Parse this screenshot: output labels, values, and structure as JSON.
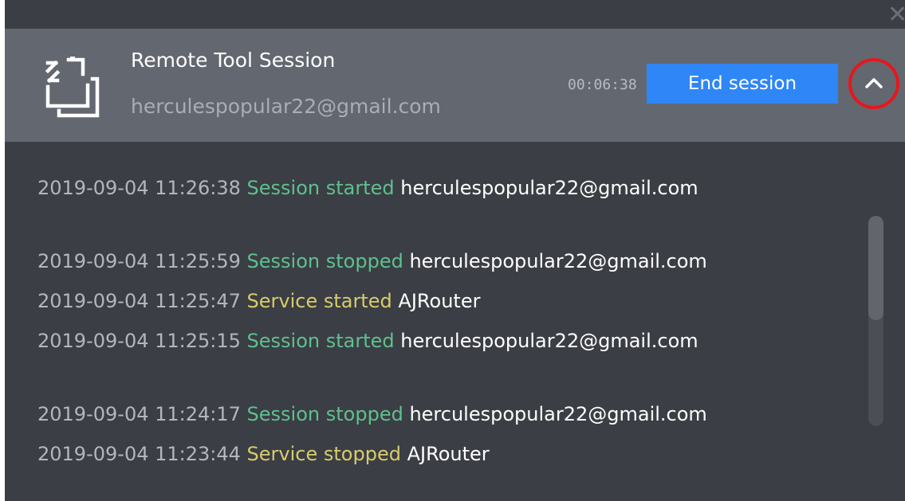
{
  "window": {
    "close_glyph": "✕"
  },
  "session": {
    "icon": "remote-session-icon",
    "title": "Remote Tool Session",
    "email": "herculespopular22@gmail.com",
    "timer": "00:06:38",
    "end_label": "End session",
    "collapse_icon": "chevron-up-icon"
  },
  "colors": {
    "header_bg": "#636770",
    "log_bg": "#3b3e44",
    "button_blue": "#2f86f6",
    "session_event": "#5fc08f",
    "service_event": "#d8cc6b",
    "highlight_circle": "#e8161b"
  },
  "log": {
    "entries": [
      {
        "timestamp": "2019-09-04 11:26:38",
        "event": "Session started",
        "target": "herculespopular22@gmail.com"
      },
      {
        "timestamp": "2019-09-04 11:25:59",
        "event": "Session stopped",
        "target": "herculespopular22@gmail.com"
      },
      {
        "timestamp": "2019-09-04 11:25:47",
        "event": "Service started",
        "target": "AJRouter"
      },
      {
        "timestamp": "2019-09-04 11:25:15",
        "event": "Session started",
        "target": "herculespopular22@gmail.com"
      },
      {
        "timestamp": "2019-09-04 11:24:17",
        "event": "Session stopped",
        "target": "herculespopular22@gmail.com"
      },
      {
        "timestamp": "2019-09-04 11:23:44",
        "event": "Service stopped",
        "target": "AJRouter"
      }
    ]
  }
}
